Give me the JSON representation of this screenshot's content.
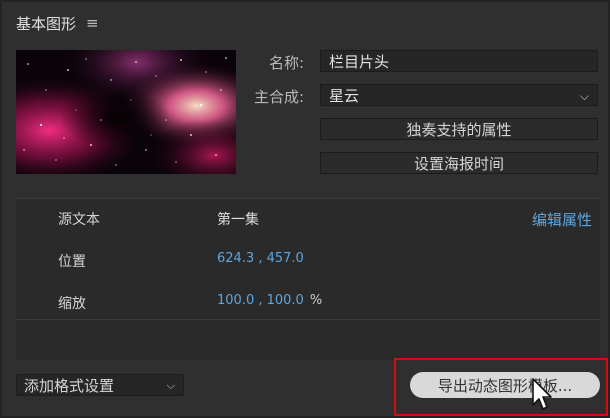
{
  "panel": {
    "title": "基本图形",
    "menu_icon": "hamburger-menu-icon"
  },
  "thumbnail": {
    "kind": "galaxy-nebula-preview"
  },
  "form": {
    "name_label": "名称:",
    "name_value": "栏目片头",
    "master_label": "主合成:",
    "master_value": "星云",
    "solo_button": "独奏支持的属性",
    "poster_button": "设置海报时间"
  },
  "properties": {
    "edit_link": "编辑属性",
    "rows": [
      {
        "name": "源文本",
        "value": "第一集",
        "unit": ""
      },
      {
        "name": "位置",
        "value": "624.3 , 457.0",
        "unit": ""
      },
      {
        "name": "缩放",
        "value": "100.0 , 100.0",
        "unit": "%"
      }
    ]
  },
  "footer": {
    "format_select": "添加格式设置",
    "export_button": "导出动态图形模板..."
  },
  "colors": {
    "accent_blue": "#5ea6df",
    "highlight_red": "#d40d13",
    "panel_bg": "#2f2f2f"
  }
}
